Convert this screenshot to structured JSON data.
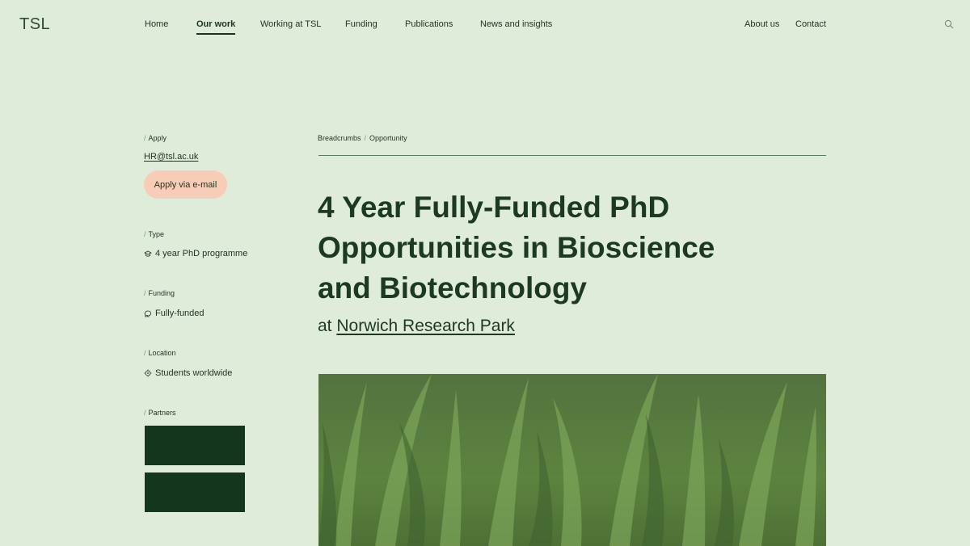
{
  "header": {
    "logo": "TSL",
    "nav_left": [
      "Home",
      "Our work",
      "Working at TSL",
      "Funding",
      "Publications",
      "News and insights"
    ],
    "nav_right": [
      "About us",
      "Contact"
    ],
    "active": "Our work"
  },
  "sidebar": {
    "apply_label": "Apply",
    "email": "HR@tsl.ac.uk",
    "apply_button": "Apply via e-mail",
    "type_label": "Type",
    "type_value": "4 year PhD programme",
    "funding_label": "Funding",
    "funding_value": "Fully-funded",
    "location_label": "Location",
    "location_value": "Students worldwide",
    "partners_label": "Partners"
  },
  "breadcrumb": {
    "root": "Breadcrumbs",
    "current": "Opportunity"
  },
  "main": {
    "title_line1": "4 Year Fully-Funded PhD",
    "title_line2": "Opportunities in Bioscience",
    "title_line3": "and Biotechnology",
    "subtitle_prefix": "at",
    "subtitle_link": "Norwich Research Park"
  },
  "icons": {
    "search": "search-icon",
    "type": "graduation-cap-icon",
    "funding": "piggy-bank-icon",
    "location": "globe-target-icon"
  },
  "colors": {
    "background": "#e0ecda",
    "text": "#1c3320",
    "accent_slash": "#6aa56e",
    "button": "#f7cdb8",
    "partner_block": "#14361a"
  }
}
